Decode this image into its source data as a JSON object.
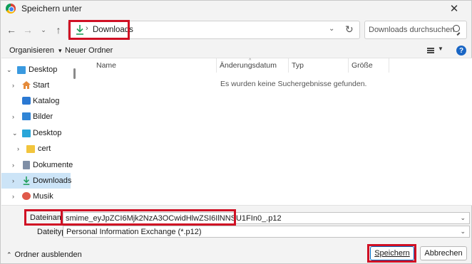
{
  "window": {
    "title": "Speichern unter"
  },
  "nav": {
    "address_text": "Downloads",
    "address_separator": "›",
    "search_placeholder": "Downloads durchsuchen"
  },
  "toolbar": {
    "organize_label": "Organisieren",
    "organize_chevron": "▾",
    "new_folder_label": "Neuer Ordner"
  },
  "sidebar": {
    "items": [
      {
        "label": "Desktop",
        "icon": "desktop-blue-icon",
        "chevron": "⌄"
      },
      {
        "label": "Start",
        "icon": "home-icon",
        "chevron": "›"
      },
      {
        "label": "Katalog",
        "icon": "gallery-icon",
        "chevron": ""
      },
      {
        "label": "Bilder",
        "icon": "pictures-icon",
        "chevron": "›"
      },
      {
        "label": "Desktop",
        "icon": "desktop-teal-icon",
        "chevron": "⌄"
      },
      {
        "label": "cert",
        "icon": "folder-icon",
        "chevron": "›"
      },
      {
        "label": "Dokumente",
        "icon": "documents-icon",
        "chevron": "›"
      },
      {
        "label": "Downloads",
        "icon": "download-icon",
        "chevron": "›",
        "selected": true
      },
      {
        "label": "Musik",
        "icon": "music-icon",
        "chevron": "›"
      }
    ]
  },
  "columns": [
    "Name",
    "Änderungsdatum",
    "Typ",
    "Größe"
  ],
  "empty_message": "Es wurden keine Suchergebnisse gefunden.",
  "form": {
    "filename_label": "Dateiname:",
    "filename_value": "smime_eyJpZCI6Mjk2NzA3OCwidHlwZSI6IlNNSU1FIn0_.p12",
    "filetype_label": "Dateityp:",
    "filetype_value": "Personal Information Exchange (*.p12)"
  },
  "footer": {
    "hide_folders_label": "Ordner ausblenden",
    "save_label": "Speichern",
    "cancel_label": "Abbrechen"
  },
  "colors": {
    "highlight_red": "#d01024",
    "selection_blue": "#cce4f7",
    "accent_blue": "#0067c0",
    "download_green": "#1e9e5a"
  }
}
